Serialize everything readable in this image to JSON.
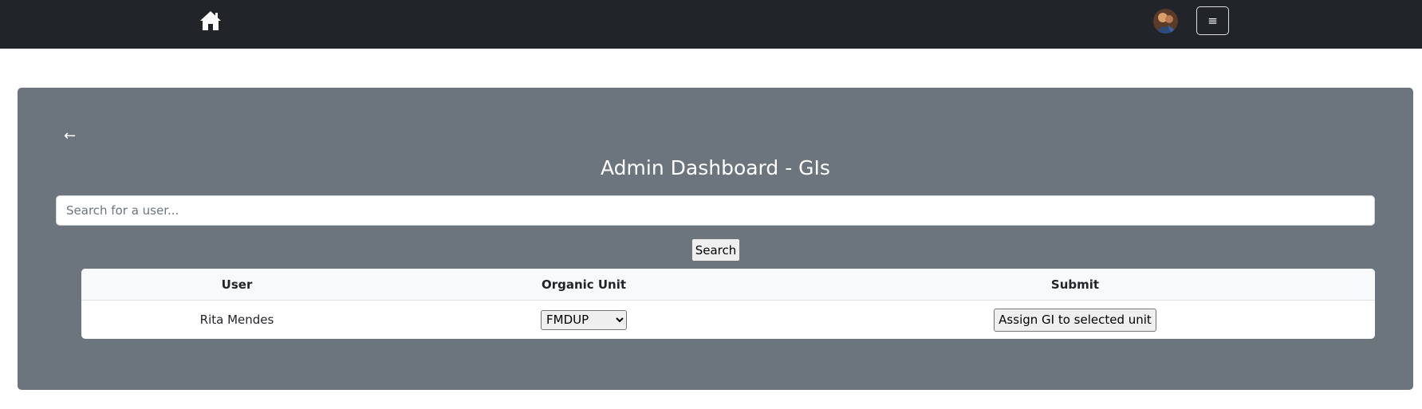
{
  "navbar": {
    "home_icon": "home-icon",
    "avatar_icon": "user-avatar",
    "menu_label": "≡",
    "background": "#212529"
  },
  "panel": {
    "back_label": "←",
    "title": "Admin Dashboard - GIs",
    "background": "#6c757d"
  },
  "search": {
    "placeholder": "Search for a user...",
    "value": "",
    "button_label": "Search"
  },
  "table": {
    "headers": [
      "User",
      "Organic Unit",
      "Submit"
    ],
    "rows": [
      {
        "user": "Rita Mendes",
        "organic_unit": "FMDUP",
        "submit_label": "Assign GI to selected unit"
      }
    ]
  }
}
